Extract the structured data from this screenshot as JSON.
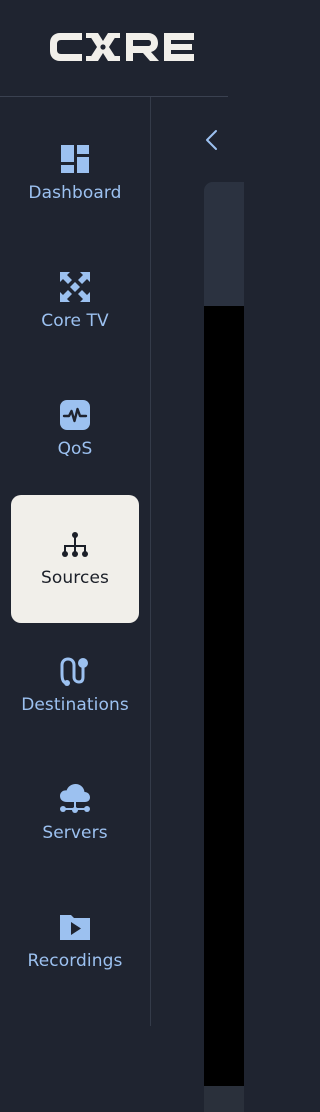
{
  "brand": {
    "logo_text": "CORE",
    "logo_color": "#f1efea"
  },
  "colors": {
    "background": "#1f2430",
    "nav_text": "#9cc1f0",
    "active_bg": "#f1efea",
    "active_text": "#1b1f28"
  },
  "sidebar": {
    "items": [
      {
        "label": "Dashboard",
        "icon": "dashboard-icon",
        "active": false
      },
      {
        "label": "Core TV",
        "icon": "core-tv-icon",
        "active": false
      },
      {
        "label": "QoS",
        "icon": "qos-pulse-icon",
        "active": false
      },
      {
        "label": "Sources",
        "icon": "sources-tree-icon",
        "active": true
      },
      {
        "label": "Destinations",
        "icon": "destinations-route-icon",
        "active": false
      },
      {
        "label": "Servers",
        "icon": "servers-cloud-icon",
        "active": false
      },
      {
        "label": "Recordings",
        "icon": "recordings-folder-icon",
        "active": false
      }
    ]
  },
  "content": {
    "collapse_icon": "chevron-left-icon"
  }
}
